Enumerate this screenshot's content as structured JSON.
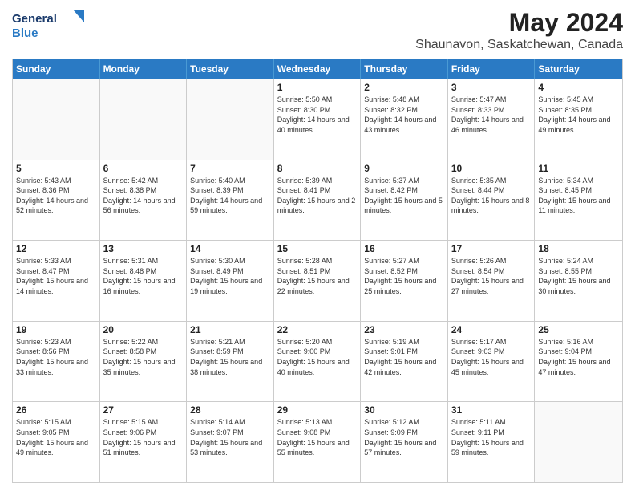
{
  "header": {
    "logo_text_general": "General",
    "logo_text_blue": "Blue",
    "month_year": "May 2024",
    "location": "Shaunavon, Saskatchewan, Canada"
  },
  "weekdays": [
    "Sunday",
    "Monday",
    "Tuesday",
    "Wednesday",
    "Thursday",
    "Friday",
    "Saturday"
  ],
  "weeks": [
    [
      {
        "day": "",
        "sunrise": "",
        "sunset": "",
        "daylight": ""
      },
      {
        "day": "",
        "sunrise": "",
        "sunset": "",
        "daylight": ""
      },
      {
        "day": "",
        "sunrise": "",
        "sunset": "",
        "daylight": ""
      },
      {
        "day": "1",
        "sunrise": "Sunrise: 5:50 AM",
        "sunset": "Sunset: 8:30 PM",
        "daylight": "Daylight: 14 hours and 40 minutes."
      },
      {
        "day": "2",
        "sunrise": "Sunrise: 5:48 AM",
        "sunset": "Sunset: 8:32 PM",
        "daylight": "Daylight: 14 hours and 43 minutes."
      },
      {
        "day": "3",
        "sunrise": "Sunrise: 5:47 AM",
        "sunset": "Sunset: 8:33 PM",
        "daylight": "Daylight: 14 hours and 46 minutes."
      },
      {
        "day": "4",
        "sunrise": "Sunrise: 5:45 AM",
        "sunset": "Sunset: 8:35 PM",
        "daylight": "Daylight: 14 hours and 49 minutes."
      }
    ],
    [
      {
        "day": "5",
        "sunrise": "Sunrise: 5:43 AM",
        "sunset": "Sunset: 8:36 PM",
        "daylight": "Daylight: 14 hours and 52 minutes."
      },
      {
        "day": "6",
        "sunrise": "Sunrise: 5:42 AM",
        "sunset": "Sunset: 8:38 PM",
        "daylight": "Daylight: 14 hours and 56 minutes."
      },
      {
        "day": "7",
        "sunrise": "Sunrise: 5:40 AM",
        "sunset": "Sunset: 8:39 PM",
        "daylight": "Daylight: 14 hours and 59 minutes."
      },
      {
        "day": "8",
        "sunrise": "Sunrise: 5:39 AM",
        "sunset": "Sunset: 8:41 PM",
        "daylight": "Daylight: 15 hours and 2 minutes."
      },
      {
        "day": "9",
        "sunrise": "Sunrise: 5:37 AM",
        "sunset": "Sunset: 8:42 PM",
        "daylight": "Daylight: 15 hours and 5 minutes."
      },
      {
        "day": "10",
        "sunrise": "Sunrise: 5:35 AM",
        "sunset": "Sunset: 8:44 PM",
        "daylight": "Daylight: 15 hours and 8 minutes."
      },
      {
        "day": "11",
        "sunrise": "Sunrise: 5:34 AM",
        "sunset": "Sunset: 8:45 PM",
        "daylight": "Daylight: 15 hours and 11 minutes."
      }
    ],
    [
      {
        "day": "12",
        "sunrise": "Sunrise: 5:33 AM",
        "sunset": "Sunset: 8:47 PM",
        "daylight": "Daylight: 15 hours and 14 minutes."
      },
      {
        "day": "13",
        "sunrise": "Sunrise: 5:31 AM",
        "sunset": "Sunset: 8:48 PM",
        "daylight": "Daylight: 15 hours and 16 minutes."
      },
      {
        "day": "14",
        "sunrise": "Sunrise: 5:30 AM",
        "sunset": "Sunset: 8:49 PM",
        "daylight": "Daylight: 15 hours and 19 minutes."
      },
      {
        "day": "15",
        "sunrise": "Sunrise: 5:28 AM",
        "sunset": "Sunset: 8:51 PM",
        "daylight": "Daylight: 15 hours and 22 minutes."
      },
      {
        "day": "16",
        "sunrise": "Sunrise: 5:27 AM",
        "sunset": "Sunset: 8:52 PM",
        "daylight": "Daylight: 15 hours and 25 minutes."
      },
      {
        "day": "17",
        "sunrise": "Sunrise: 5:26 AM",
        "sunset": "Sunset: 8:54 PM",
        "daylight": "Daylight: 15 hours and 27 minutes."
      },
      {
        "day": "18",
        "sunrise": "Sunrise: 5:24 AM",
        "sunset": "Sunset: 8:55 PM",
        "daylight": "Daylight: 15 hours and 30 minutes."
      }
    ],
    [
      {
        "day": "19",
        "sunrise": "Sunrise: 5:23 AM",
        "sunset": "Sunset: 8:56 PM",
        "daylight": "Daylight: 15 hours and 33 minutes."
      },
      {
        "day": "20",
        "sunrise": "Sunrise: 5:22 AM",
        "sunset": "Sunset: 8:58 PM",
        "daylight": "Daylight: 15 hours and 35 minutes."
      },
      {
        "day": "21",
        "sunrise": "Sunrise: 5:21 AM",
        "sunset": "Sunset: 8:59 PM",
        "daylight": "Daylight: 15 hours and 38 minutes."
      },
      {
        "day": "22",
        "sunrise": "Sunrise: 5:20 AM",
        "sunset": "Sunset: 9:00 PM",
        "daylight": "Daylight: 15 hours and 40 minutes."
      },
      {
        "day": "23",
        "sunrise": "Sunrise: 5:19 AM",
        "sunset": "Sunset: 9:01 PM",
        "daylight": "Daylight: 15 hours and 42 minutes."
      },
      {
        "day": "24",
        "sunrise": "Sunrise: 5:17 AM",
        "sunset": "Sunset: 9:03 PM",
        "daylight": "Daylight: 15 hours and 45 minutes."
      },
      {
        "day": "25",
        "sunrise": "Sunrise: 5:16 AM",
        "sunset": "Sunset: 9:04 PM",
        "daylight": "Daylight: 15 hours and 47 minutes."
      }
    ],
    [
      {
        "day": "26",
        "sunrise": "Sunrise: 5:15 AM",
        "sunset": "Sunset: 9:05 PM",
        "daylight": "Daylight: 15 hours and 49 minutes."
      },
      {
        "day": "27",
        "sunrise": "Sunrise: 5:15 AM",
        "sunset": "Sunset: 9:06 PM",
        "daylight": "Daylight: 15 hours and 51 minutes."
      },
      {
        "day": "28",
        "sunrise": "Sunrise: 5:14 AM",
        "sunset": "Sunset: 9:07 PM",
        "daylight": "Daylight: 15 hours and 53 minutes."
      },
      {
        "day": "29",
        "sunrise": "Sunrise: 5:13 AM",
        "sunset": "Sunset: 9:08 PM",
        "daylight": "Daylight: 15 hours and 55 minutes."
      },
      {
        "day": "30",
        "sunrise": "Sunrise: 5:12 AM",
        "sunset": "Sunset: 9:09 PM",
        "daylight": "Daylight: 15 hours and 57 minutes."
      },
      {
        "day": "31",
        "sunrise": "Sunrise: 5:11 AM",
        "sunset": "Sunset: 9:11 PM",
        "daylight": "Daylight: 15 hours and 59 minutes."
      },
      {
        "day": "",
        "sunrise": "",
        "sunset": "",
        "daylight": ""
      }
    ]
  ]
}
